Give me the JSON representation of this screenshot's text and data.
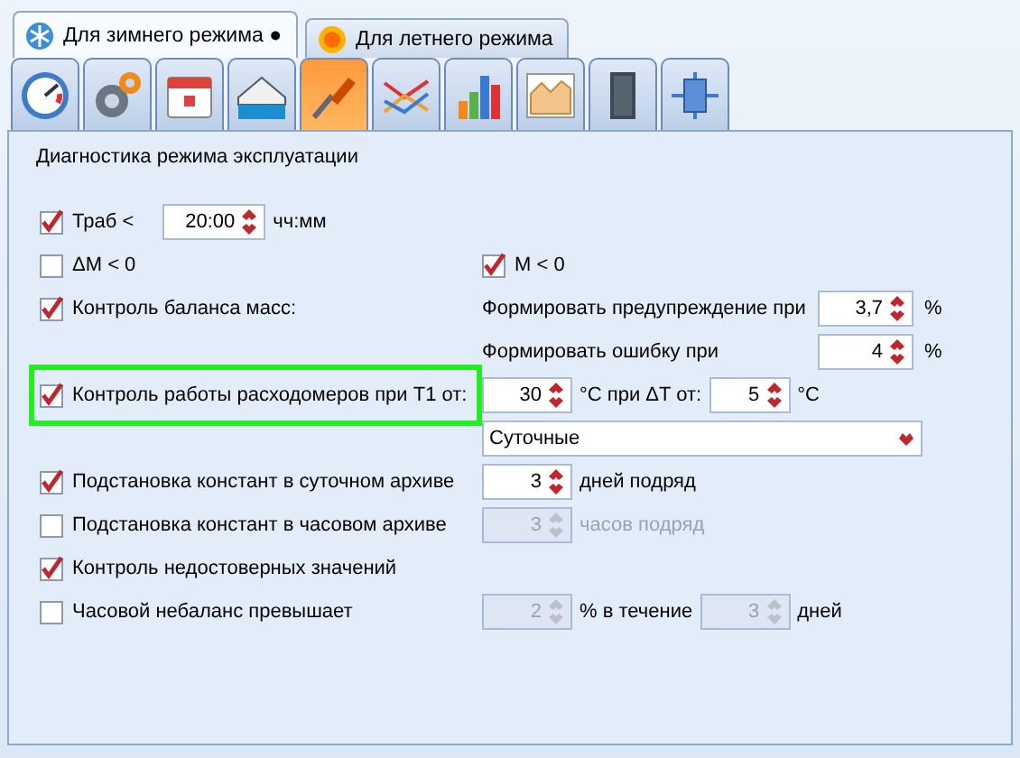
{
  "mode_tabs": [
    {
      "label": "Для зимнего режима",
      "mark": "●",
      "kind": "snowflake",
      "selected": true
    },
    {
      "label": "Для летнего режима",
      "kind": "sun",
      "selected": false
    }
  ],
  "toolbar": [
    {
      "kind": "gauge",
      "selected": false
    },
    {
      "kind": "gears",
      "selected": false
    },
    {
      "kind": "calendar",
      "selected": false
    },
    {
      "kind": "house_water",
      "selected": false
    },
    {
      "kind": "screwdriver",
      "selected": true
    },
    {
      "kind": "lines",
      "selected": false
    },
    {
      "kind": "bars",
      "selected": false
    },
    {
      "kind": "area",
      "selected": false
    },
    {
      "kind": "panel",
      "selected": false
    },
    {
      "kind": "chip",
      "selected": false
    }
  ],
  "section_title": "Диагностика режима эксплуатации",
  "work_time": {
    "label": "Траб <",
    "checked": true,
    "value": "20:00",
    "unit": "чч:мм"
  },
  "delta_m": {
    "label": "ΔM < 0",
    "checked": false
  },
  "m_negative": {
    "label": "M < 0",
    "checked": true
  },
  "mass_balance": {
    "label": "Контроль баланса масс:",
    "checked": true,
    "warning": {
      "label": "Формировать предупреждение при",
      "value": "3,7",
      "unit": "%"
    },
    "error": {
      "label": "Формировать ошибку при",
      "value": "4",
      "unit": "%"
    }
  },
  "flowmeter": {
    "label": "Контроль работы расходомеров при Т1 от:",
    "checked": true,
    "highlighted": true,
    "t1_value": "30",
    "t1_unit": "°C при ΔT от:",
    "dt_value": "5",
    "dt_unit": "°C",
    "archive": "Суточные"
  },
  "daily_subst": {
    "label": "Подстановка констант в суточном архиве",
    "checked": true,
    "value": "3",
    "disabled": false,
    "unit": "дней подряд"
  },
  "hourly_subst": {
    "label": "Подстановка констант в часовом архиве",
    "checked": false,
    "value": "3",
    "disabled": true,
    "unit": "часов подряд",
    "unit_disabled": true
  },
  "unreliable": {
    "label": "Контроль недостоверных значений",
    "checked": true
  },
  "hourly_imbalance": {
    "label": "Часовой небаланс превышает",
    "checked": false,
    "value": "2",
    "disabled": true,
    "unit": "% в течение",
    "days_value": "3",
    "days_disabled": true,
    "days_unit": "дней"
  }
}
